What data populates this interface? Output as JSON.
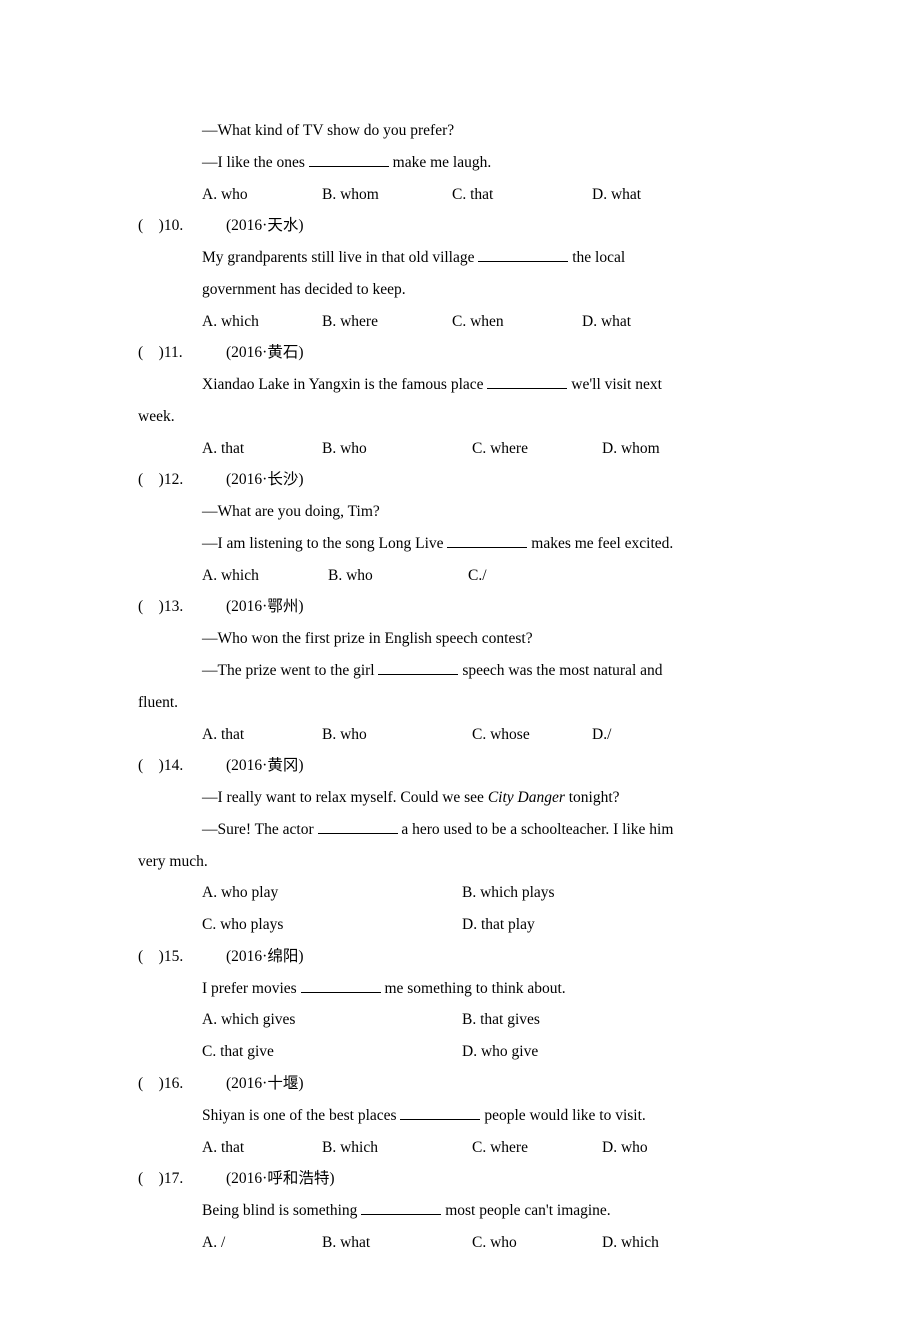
{
  "q9": {
    "line1": "—What kind of TV show do you prefer?",
    "line2a": "—I like the ones ",
    "line2b": " make me laugh.",
    "optA": "A. who",
    "optB": "B. whom",
    "optC": "C. that",
    "optD": "D. what"
  },
  "q10": {
    "paren": "(",
    "parenClose": ")10.",
    "meta": " (2016·天水)",
    "line1a": "My grandparents still live in that old village ",
    "line1b": " the local",
    "line2": "government has decided to keep.",
    "optA": "A. which",
    "optB": "B. where",
    "optC": "C. when",
    "optD": "D. what"
  },
  "q11": {
    "paren": "(",
    "parenClose": ")11.",
    "meta": " (2016·黄石)",
    "line1a": "Xiandao Lake in Yangxin is the famous place ",
    "line1b": " we'll visit next",
    "line2": "week.",
    "optA": "A. that",
    "optB": "B. who",
    "optC": "C. where",
    "optD": "D. whom"
  },
  "q12": {
    "paren": "(",
    "parenClose": ")12.",
    "meta": " (2016·长沙)",
    "line1": "—What are you doing, Tim?",
    "line2a": "—I am listening to the song Long Live ",
    "line2b": " makes me feel excited.",
    "optA": "A. which",
    "optB": "B. who",
    "optC": "C./"
  },
  "q13": {
    "paren": "(",
    "parenClose": ")13.",
    "meta": " (2016·鄂州)",
    "line1": "—Who won the first prize in English speech contest?",
    "line2a": "—The prize went to the girl ",
    "line2b": " speech was the most natural and",
    "line3": "fluent.",
    "optA": "A. that",
    "optB": "B. who",
    "optC": "C. whose",
    "optD": "D./"
  },
  "q14": {
    "paren": "(",
    "parenClose": ")14.",
    "meta": " (2016·黄冈)",
    "line1a": "—I really want to relax myself. Could we see ",
    "line1italic": "City Danger",
    "line1b": " tonight?",
    "line2a": "—Sure! The actor ",
    "line2b": " a hero used to be a schoolteacher. I like him",
    "line3": "very much.",
    "optA": "A. who play",
    "optB": "B. which plays",
    "optC": "C. who plays",
    "optD": "D. that play"
  },
  "q15": {
    "paren": "(",
    "parenClose": ")15.",
    "meta": " (2016·绵阳)",
    "line1a": "I prefer movies ",
    "line1b": " me something to think about.",
    "optA": "A. which gives",
    "optB": "B. that gives",
    "optC": "C. that give",
    "optD": "D. who give"
  },
  "q16": {
    "paren": "(",
    "parenClose": ")16.",
    "meta": " (2016·十堰)",
    "line1a": "Shiyan is one of the best places ",
    "line1b": " people would like to visit.",
    "optA": "A. that",
    "optB": "B. which",
    "optC": "C. where",
    "optD": "D. who"
  },
  "q17": {
    "paren": "(",
    "parenClose": ")17.",
    "meta": " (2016·呼和浩特)",
    "line1a": "Being blind is something ",
    "line1b": " most people can't imagine.",
    "optA": "A. /",
    "optB": "B. what",
    "optC": "C. who",
    "optD": "D. which"
  }
}
